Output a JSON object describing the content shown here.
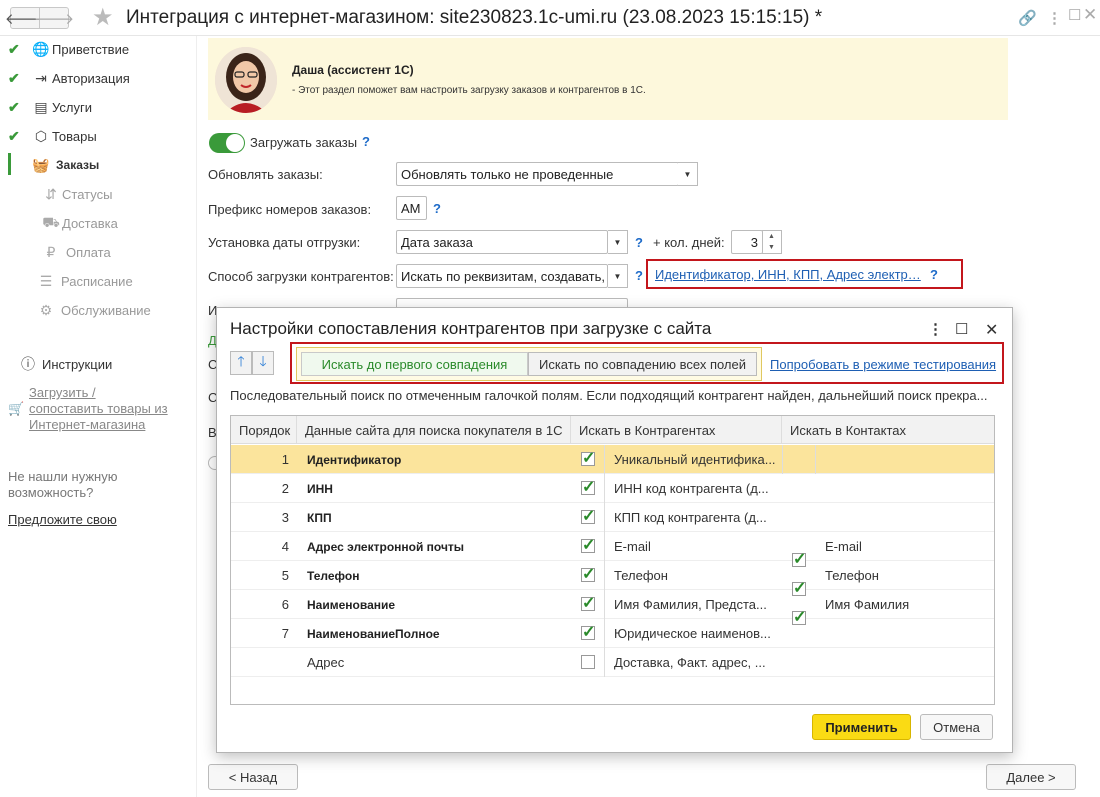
{
  "window": {
    "title": "Интеграция с интернет-магазином: site230823.1c-umi.ru (23.08.2023 15:15:15) *"
  },
  "sidebar": {
    "steps": [
      {
        "label": "Приветствие",
        "icon": "globe-icon",
        "done": true
      },
      {
        "label": "Авторизация",
        "icon": "login-icon",
        "done": true
      },
      {
        "label": "Услуги",
        "icon": "services-icon",
        "done": true
      },
      {
        "label": "Товары",
        "icon": "box-icon",
        "done": true
      },
      {
        "label": "Заказы",
        "icon": "basket-icon",
        "done": false
      }
    ],
    "substeps": [
      {
        "label": "Статусы",
        "icon": "statuses-icon"
      },
      {
        "label": "Доставка",
        "icon": "delivery-icon"
      },
      {
        "label": "Оплата",
        "icon": "ruble-icon"
      }
    ],
    "extra": [
      {
        "label": "Расписание",
        "icon": "schedule-icon"
      },
      {
        "label": "Обслуживание",
        "icon": "gear-icon"
      }
    ],
    "instructions": "Инструкции",
    "upload_link": [
      "Загрузить /",
      "сопоставить товары из",
      "Интернет-магазина"
    ],
    "not_found": [
      "Не нашли нужную",
      "возможность?"
    ],
    "suggest_link": "Предложите свою"
  },
  "assistant": {
    "name": "Даша (ассистент 1С)",
    "text": "- Этот раздел поможет вам настроить загрузку заказов и контрагентов в 1С."
  },
  "form": {
    "load_orders_label": "Загружать заказы",
    "load_orders_on": true,
    "update_orders_label": "Обновлять заказы:",
    "update_orders_value": "Обновлять только не проведенные",
    "prefix_label": "Префикс номеров заказов:",
    "prefix_value": "АМ",
    "ship_date_label": "Установка даты отгрузки:",
    "ship_date_value": "Дата заказа",
    "plus_days_label": "+ кол. дней:",
    "plus_days_value": "3",
    "contractor_label": "Способ загрузки контрагентов:",
    "contractor_value": "Искать по реквизитам, создавать,",
    "contractor_link": "Идентификатор, ИНН, КПП, Адрес электр…",
    "help": "?",
    "hidden_row_label": "И",
    "hidden_row2": "Д",
    "hidden_row3": "С",
    "hidden_row4": "С",
    "hidden_row5": "В"
  },
  "dialog": {
    "title": "Настройки сопоставления контрагентов при загрузке с сайта",
    "mode_first": "Искать до первого совпадения",
    "mode_all": "Искать по совпадению всех полей",
    "test_link": "Попробовать в режиме тестирования",
    "description": "Последовательный поиск по отмеченным галочкой полям. Если подходящий контрагент найден, дальнейший поиск прекра...",
    "columns": [
      "Порядок",
      "Данные сайта для поиска покупателя в 1С",
      "Искать в Контрагентах",
      "Искать в Контактах"
    ],
    "rows": [
      {
        "order": "1",
        "field": "Идентификатор",
        "c_on": true,
        "c_text": "Уникальный идентифика...",
        "k_on": null,
        "k_text": "",
        "selected": true
      },
      {
        "order": "2",
        "field": "ИНН",
        "c_on": true,
        "c_text": "ИНН код контрагента (д...",
        "k_on": null,
        "k_text": ""
      },
      {
        "order": "3",
        "field": "КПП",
        "c_on": true,
        "c_text": "КПП код контрагента (д...",
        "k_on": null,
        "k_text": ""
      },
      {
        "order": "4",
        "field": "Адрес электронной почты",
        "c_on": true,
        "c_text": "E-mail",
        "k_on": true,
        "k_text": "E-mail"
      },
      {
        "order": "5",
        "field": "Телефон",
        "c_on": true,
        "c_text": "Телефон",
        "k_on": true,
        "k_text": "Телефон"
      },
      {
        "order": "6",
        "field": "Наименование",
        "c_on": true,
        "c_text": "Имя Фамилия, Предста...",
        "k_on": true,
        "k_text": "Имя Фамилия"
      },
      {
        "order": "7",
        "field": "НаименованиеПолное",
        "c_on": true,
        "c_text": "Юридическое наименов...",
        "k_on": null,
        "k_text": ""
      },
      {
        "order": "",
        "field": "Адрес",
        "c_on": false,
        "c_text": "Доставка, Факт. адрес, ...",
        "k_on": null,
        "k_text": "",
        "plain": true
      }
    ],
    "apply": "Применить",
    "cancel": "Отмена"
  },
  "footer": {
    "back": "< Назад",
    "next": "Далее >"
  },
  "colors": {
    "accent_green": "#3a9a3a",
    "selected_row": "#fbe49c",
    "primary_button": "#fadb14",
    "highlight_border": "#c3161c",
    "link": "#1e5fb3"
  }
}
